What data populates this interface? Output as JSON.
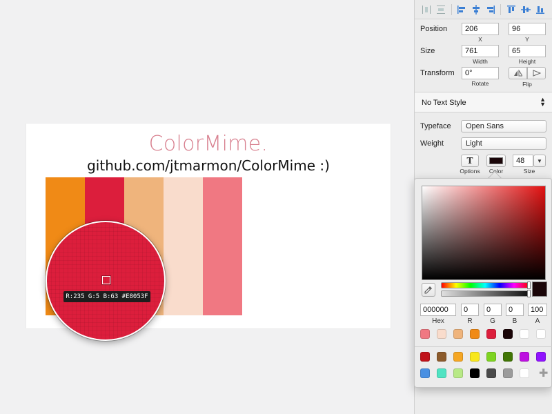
{
  "artboard": {
    "title": "ColorMime.",
    "subtitle": "github.com/jtmarmon/ColorMime :)",
    "swatches": [
      "#f08a16",
      "#dc1e3c",
      "#efb47c",
      "#f9dccc",
      "#f07882"
    ]
  },
  "magnifier": {
    "readout": "R:235 G:5 B:63 #E8053F"
  },
  "inspector": {
    "position": {
      "label": "Position",
      "x": "206",
      "y": "96",
      "x_cap": "X",
      "y_cap": "Y"
    },
    "size": {
      "label": "Size",
      "width": "761",
      "height": "65",
      "width_cap": "Width",
      "height_cap": "Height"
    },
    "transform": {
      "label": "Transform",
      "rotate": "0°",
      "rotate_cap": "Rotate",
      "flip_cap": "Flip"
    },
    "text_style": "No Text Style",
    "typeface": {
      "label": "Typeface",
      "value": "Open Sans"
    },
    "weight": {
      "label": "Weight",
      "value": "Light"
    },
    "options_cap": "Options",
    "color_cap": "Color",
    "font_size": "48",
    "size_cap": "Size",
    "text_color": "#1a0508"
  },
  "picker": {
    "hex": "000000",
    "r": "0",
    "g": "0",
    "b": "0",
    "a": "100",
    "hex_cap": "Hex",
    "r_cap": "R",
    "g_cap": "G",
    "b_cap": "B",
    "a_cap": "A",
    "document_colors": [
      "#f07882",
      "#f9dccc",
      "#efb47c",
      "#f08a16",
      "#dc1e3c",
      "#1a0508",
      "#ffffff",
      "#ffffff"
    ],
    "global_colors": [
      "#c0131b",
      "#8b5a2b",
      "#f5a623",
      "#f8e71c",
      "#7ed321",
      "#417505",
      "#bd10e0",
      "#9013fe",
      "#4a90e2",
      "#50e3c2",
      "#b8e986",
      "#000000",
      "#4a4a4a",
      "#9b9b9b",
      "#ffffff"
    ]
  }
}
